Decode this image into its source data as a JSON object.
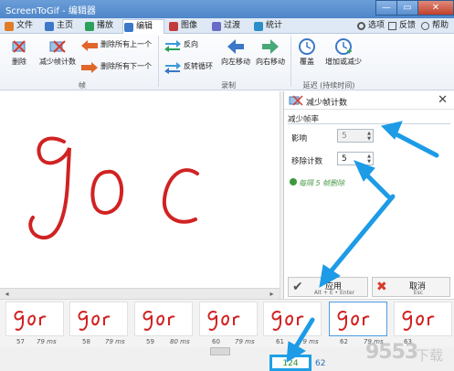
{
  "window": {
    "title": "ScreenToGif - 编辑器",
    "controls": [
      "—",
      "▭",
      "✕"
    ]
  },
  "tabs": [
    {
      "label": "文件",
      "icon": "file-icon",
      "color": "#e07b2a"
    },
    {
      "label": "主页",
      "icon": "home-icon",
      "color": "#3b78c7"
    },
    {
      "label": "播放",
      "icon": "play-icon",
      "color": "#2aa05a"
    },
    {
      "label": "编辑",
      "icon": "edit-icon",
      "color": "#3b78c7",
      "active": true
    },
    {
      "label": "图像",
      "icon": "image-icon",
      "color": "#c23b3b"
    },
    {
      "label": "过渡",
      "icon": "transition-icon",
      "color": "#6a6ac7"
    },
    {
      "label": "统计",
      "icon": "stats-icon",
      "color": "#2a8fc7"
    }
  ],
  "topright": {
    "options": "选项",
    "feedback": "反馈",
    "help": "帮助"
  },
  "ribbon": {
    "frames_group": "帧",
    "delete": "删除",
    "reduce": "减少帧计数",
    "delete_prev": "删除所有上一个",
    "delete_next": "删除所有下一个",
    "record_group": "录制",
    "reverse": "反向",
    "yoyo": "反转循环",
    "move_left": "向左移动",
    "move_right": "向右移动",
    "delay_group": "延迟 (持续时间)",
    "override": "覆盖",
    "increase_decrease": "增加或减少"
  },
  "canvas": {
    "text": "goc",
    "ink_color": "#d12222"
  },
  "panel": {
    "title": "减少帧计数",
    "section": "减少帧率",
    "factor_label": "影响",
    "factor_value": "5",
    "remove_label": "移除计数",
    "remove_value": "5",
    "info": "每隔 5 帧删除",
    "apply_label": "应用",
    "apply_hint": "Alt + E • Enter",
    "cancel_label": "取消",
    "cancel_hint": "Esc"
  },
  "filmstrip": {
    "frames": [
      {
        "num": "57",
        "ms": "79 ms"
      },
      {
        "num": "58",
        "ms": "79 ms"
      },
      {
        "num": "59",
        "ms": "80 ms"
      },
      {
        "num": "60",
        "ms": "79 ms"
      },
      {
        "num": "61",
        "ms": "79 ms"
      },
      {
        "num": "62",
        "ms": "79 ms",
        "selected": true
      },
      {
        "num": "63",
        "ms": ""
      }
    ],
    "thumb_text": "goc"
  },
  "status": {
    "frame_count": "124",
    "selected_count": "62"
  },
  "annotation_color": "#1d9be6",
  "watermark": {
    "main": "9553",
    "sub": "下载"
  }
}
